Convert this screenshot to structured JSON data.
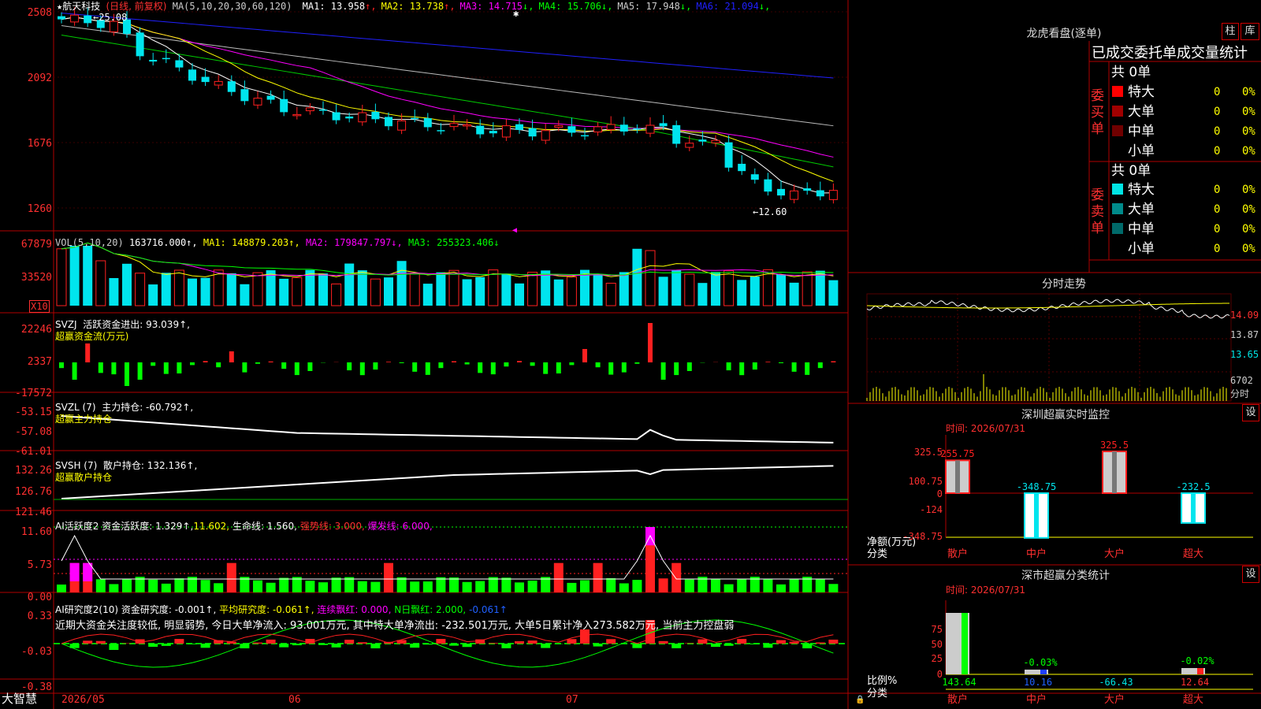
{
  "header": {
    "star": "★",
    "stock_name": "航天科技",
    "period": "(日线, 前复权)",
    "ma_label": "MA(5,10,20,30,60,120)",
    "ma": [
      {
        "label": "MA1:",
        "value": "13.958",
        "arrow": "↑",
        "color": "#ffffff"
      },
      {
        "label": "MA2:",
        "value": "13.738",
        "arrow": "↑",
        "color": "#ffff00"
      },
      {
        "label": "MA3:",
        "value": "14.715",
        "arrow": "↓",
        "color": "#ff00ff"
      },
      {
        "label": "MA4:",
        "value": "15.706",
        "arrow": "↓",
        "color": "#00ff00"
      },
      {
        "label": "MA5:",
        "value": "17.948",
        "arrow": "↓",
        "color": "#cccccc"
      },
      {
        "label": "MA6:",
        "value": "21.094",
        "arrow": "↓",
        "color": "#2020ff"
      }
    ],
    "high_mark": "←25.08",
    "low_mark": "←12.60"
  },
  "axes": {
    "price": [
      "2508",
      "2092",
      "1676",
      "1260"
    ],
    "vol": [
      "67879",
      "33520",
      "X10"
    ],
    "svzj": [
      "22246",
      "2337",
      "-17572"
    ],
    "svzl": [
      "-53.15",
      "-57.08",
      "-61.01"
    ],
    "svsh": [
      "132.26",
      "126.76",
      "121.46"
    ],
    "ai": [
      "11.60",
      "5.73",
      "0.00"
    ],
    "res": [
      "0.33",
      "-0.03",
      "-0.38"
    ]
  },
  "vol_header": {
    "label": "VOL(5,10,20)",
    "value": "163716.000↑,",
    "ma1": "MA1: 148879.203↑,",
    "ma2": "MA2: 179847.797↓,",
    "ma3": "MA3: 255323.406↓"
  },
  "svzj_header": {
    "label": "SVZJ",
    "text": "活跃资金进出: 93.039↑,",
    "sub": "超赢资金流(万元)"
  },
  "svzl_header": {
    "label": "SVZL (7)",
    "text": "主力持仓: -60.792↑,",
    "sub": "超赢主力持仓"
  },
  "svsh_header": {
    "label": "SVSH (7)",
    "text": "散户持仓: 132.136↑,",
    "sub": "超赢散户持仓"
  },
  "ai_header": {
    "label": "AI活跃度2",
    "a": "资金活跃度: 1.329↑,",
    "b": "11.602,",
    "c": "生命线: 1.560,",
    "d": "强势线: 3.000,",
    "e": "爆发线: 6.000,"
  },
  "res_header": {
    "label": "AI研究度2(10)",
    "a": "资金研究度: -0.001↑,",
    "b": "平均研究度: -0.061↑,",
    "c": "连续飘红: 0.000,",
    "d": "N日飘红: 2.000,",
    "e": "-0.061↑",
    "comment": "近期大资金关注度较低, 明显弱势, 今日大单净流入: 93.001万元, 其中特大单净流出: -232.501万元, 大单5日累计净入273.582万元, 当前主力控盘弱"
  },
  "time_axis": {
    "logo": "大智慧",
    "labels": [
      "2026/05",
      "06",
      "07"
    ]
  },
  "dragon": {
    "title": "龙虎看盘(逐单)",
    "btn1": "柱",
    "btn2": "库",
    "tabs": "已成交委托单成交量统计",
    "buy_label": "委买单",
    "sell_label": "委卖单",
    "buy_total": "共 0单",
    "sell_total": "共 0单",
    "buy_rows": [
      {
        "name": "特大",
        "v": "0",
        "p": "0%",
        "color": "#ff0000"
      },
      {
        "name": "大单",
        "v": "0",
        "p": "0%",
        "color": "#a00000"
      },
      {
        "name": "中单",
        "v": "0",
        "p": "0%",
        "color": "#700000"
      },
      {
        "name": "小单",
        "v": "0",
        "p": "0%",
        "color": ""
      }
    ],
    "sell_rows": [
      {
        "name": "特大",
        "v": "0",
        "p": "0%",
        "color": "#00e5e5"
      },
      {
        "name": "大单",
        "v": "0",
        "p": "0%",
        "color": "#008b8b"
      },
      {
        "name": "中单",
        "v": "0",
        "p": "0%",
        "color": "#006a6a"
      },
      {
        "name": "小单",
        "v": "0",
        "p": "0%",
        "color": ""
      }
    ]
  },
  "intraday": {
    "title": "分时走势",
    "prices": [
      "14.09",
      "13.87",
      "13.65"
    ],
    "vol": "6702",
    "vol_unit": "分时"
  },
  "monitor": {
    "title": "深圳超赢实时监控",
    "btn": "设",
    "time": "时间: 2026/07/31",
    "yaxis": [
      "325.5",
      "100.75",
      "0",
      "-124",
      "-348.75"
    ],
    "ylabel": "净额(万元)",
    "xlabel": "分类",
    "cats": [
      "散户",
      "中户",
      "大户",
      "超大"
    ],
    "values": [
      "255.75",
      "-348.75",
      "325.5",
      "-232.5"
    ],
    "nums": [
      255.75,
      -348.75,
      325.5,
      -232.5
    ]
  },
  "stats": {
    "title": "深市超赢分类统计",
    "btn": "设",
    "time": "时间: 2026/07/31",
    "yaxis": [
      "75",
      "50",
      "25",
      "0"
    ],
    "ylabel": "比例%",
    "xlabel": "分类",
    "cats": [
      "散户",
      "中户",
      "大户",
      "超大"
    ],
    "pcts": [
      "",
      "-0.03%",
      "",
      "-0.02%"
    ],
    "values": [
      "143.64",
      "10.16",
      "-66.43",
      "12.64"
    ]
  },
  "colors": {
    "up": "#ff2020",
    "down": "#00e5ee",
    "green": "#00ff00",
    "grid": "#b00000"
  }
}
